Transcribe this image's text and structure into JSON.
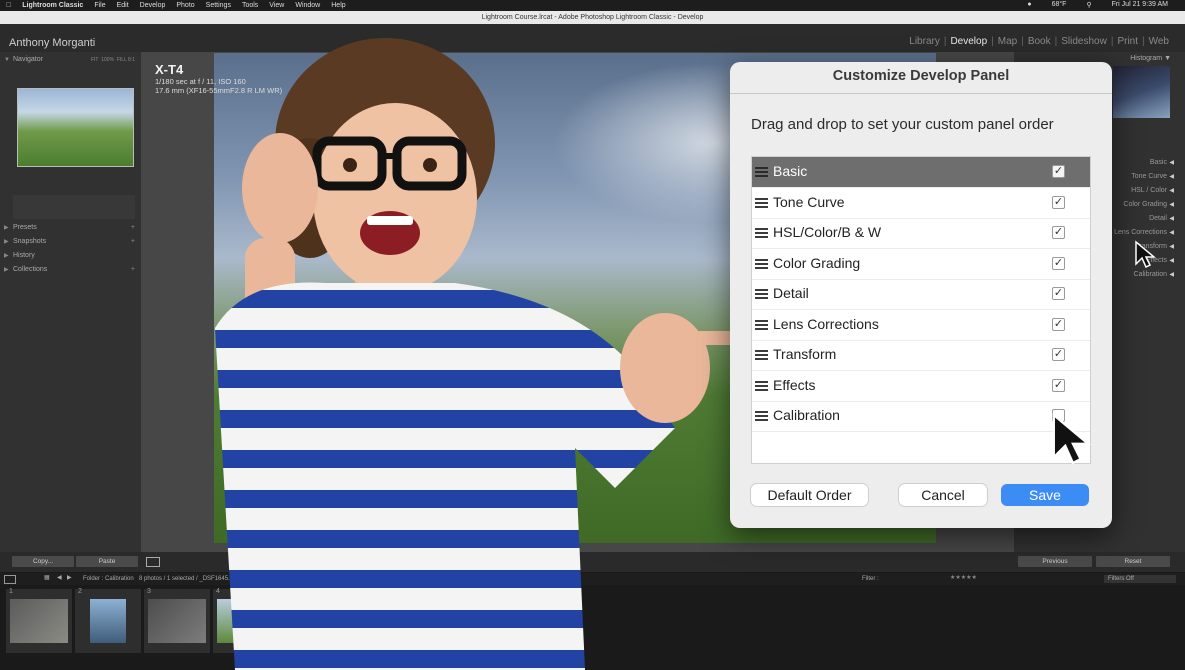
{
  "menubar": {
    "items": [
      "Lightroom Classic",
      "File",
      "Edit",
      "Develop",
      "Photo",
      "Settings",
      "Tools",
      "View",
      "Window",
      "Help"
    ],
    "temp": "68°F",
    "clock": "Fri Jul 21  9:39 AM"
  },
  "window": {
    "title": "Lightroom Course.lrcat - Adobe Photoshop Lightroom Classic - Develop"
  },
  "header": {
    "identity": "Anthony Morganti",
    "modules": [
      {
        "label": "Library",
        "active": false
      },
      {
        "label": "Develop",
        "active": true
      },
      {
        "label": "Map",
        "active": false
      },
      {
        "label": "Book",
        "active": false
      },
      {
        "label": "Slideshow",
        "active": false
      },
      {
        "label": "Print",
        "active": false
      },
      {
        "label": "Web",
        "active": false
      }
    ]
  },
  "left_panel": {
    "navigator": "Navigator",
    "nav_zoom": [
      "FIT",
      "100%",
      "FILL 8:1"
    ],
    "presets": "Presets",
    "snapshots": "Snapshots",
    "history": "History",
    "collections": "Collections",
    "copy": "Copy...",
    "paste": "Paste"
  },
  "right_panel": {
    "histogram": "Histogram",
    "items": [
      "Basic",
      "Tone Curve",
      "HSL / Color",
      "Color Grading",
      "Detail",
      "Lens Corrections",
      "Transform",
      "Effects",
      "Calibration"
    ],
    "previous": "Previous",
    "reset": "Reset"
  },
  "camera": {
    "model": "X-T4",
    "exposure": "1/180 sec at f / 11, ISO 160",
    "lens": "17.6 mm (XF16-55mmF2.8 R LM WR)"
  },
  "filmstrip": {
    "folder": "Folder : Calibration",
    "count": "8 photos / 1 selected / _DSF1645.dng",
    "filter": "Filter :",
    "filters_off": "Filters Off",
    "thumbs": [
      {
        "num": "1",
        "colors": [
          "#5b5b5b",
          "#8b8b85"
        ]
      },
      {
        "num": "2",
        "colors": [
          "#8eb0d4",
          "#3f5d7a"
        ]
      },
      {
        "num": "3",
        "colors": [
          "#4d4d4d",
          "#7d7d7d"
        ]
      },
      {
        "num": "4",
        "colors": [
          "#b8cde0",
          "#5e8a3a"
        ]
      }
    ]
  },
  "dialog": {
    "title": "Customize Develop Panel",
    "instruction": "Drag and drop to set your custom panel order",
    "panels": [
      {
        "label": "Basic",
        "checked": true,
        "selected": true
      },
      {
        "label": "Tone Curve",
        "checked": true,
        "selected": false
      },
      {
        "label": "HSL/Color/B & W",
        "checked": true,
        "selected": false
      },
      {
        "label": "Color Grading",
        "checked": true,
        "selected": false
      },
      {
        "label": "Detail",
        "checked": true,
        "selected": false
      },
      {
        "label": "Lens Corrections",
        "checked": true,
        "selected": false
      },
      {
        "label": "Transform",
        "checked": true,
        "selected": false
      },
      {
        "label": "Effects",
        "checked": true,
        "selected": false
      },
      {
        "label": "Calibration",
        "checked": false,
        "selected": false
      }
    ],
    "default_order": "Default Order",
    "cancel": "Cancel",
    "save": "Save"
  },
  "colors": {
    "accent": "#3b8df5",
    "selected_row": "#6e6e6e",
    "panel_bg": "#313131"
  }
}
